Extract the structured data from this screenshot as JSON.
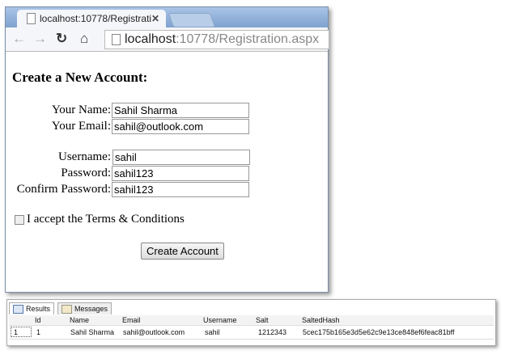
{
  "browser": {
    "tab_title": "localhost:10778/Registrati",
    "url_host": "localhost",
    "url_path": ":10778/Registration.aspx"
  },
  "form": {
    "title": "Create a New Account:",
    "fields": [
      {
        "label": "Your Name:",
        "value": "Sahil Sharma"
      },
      {
        "label": "Your Email:",
        "value": "sahil@outlook.com"
      },
      {
        "label": "Username:",
        "value": "sahil"
      },
      {
        "label": "Password:",
        "value": "sahil123"
      },
      {
        "label": "Confirm Password:",
        "value": "sahil123"
      }
    ],
    "terms": "I accept the Terms & Conditions",
    "submit": "Create Account"
  },
  "results": {
    "tabs": [
      "Results",
      "Messages"
    ],
    "columns": [
      "Id",
      "Name",
      "Email",
      "Username",
      "Salt",
      "SaltedHash"
    ],
    "rows": [
      {
        "num": "1",
        "cells": [
          "1",
          "Sahil Sharma",
          "sahil@outlook.com",
          "sahil",
          "1212343",
          "5cec175b165e3d5e62c9e13ce848ef6feac81bff"
        ]
      }
    ]
  }
}
